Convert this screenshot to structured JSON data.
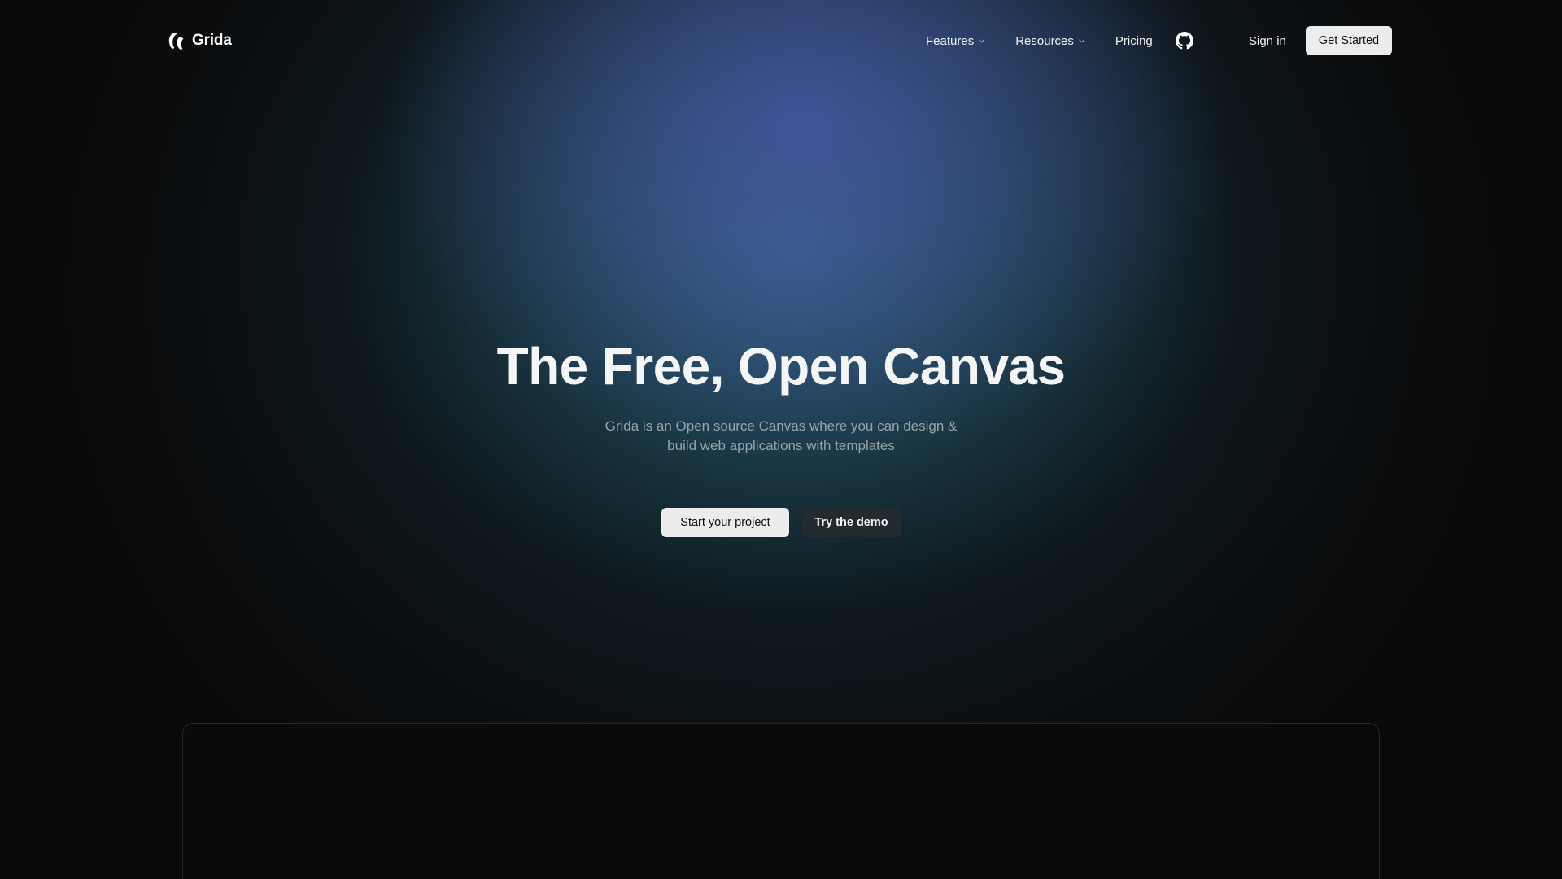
{
  "brand": {
    "name": "Grida",
    "logo_icon": "grida-logo-icon"
  },
  "nav": {
    "items": [
      {
        "label": "Features",
        "has_dropdown": true,
        "icon": "chevron-down-icon"
      },
      {
        "label": "Resources",
        "has_dropdown": true,
        "icon": "chevron-down-icon"
      },
      {
        "label": "Pricing",
        "has_dropdown": false
      }
    ],
    "github_icon": "github-icon",
    "sign_in_label": "Sign in",
    "get_started_label": "Get Started"
  },
  "hero": {
    "title": "The Free, Open Canvas",
    "subtitle_line1": "Grida is an Open source Canvas where you can design &",
    "subtitle_line2": "build web applications with templates",
    "primary_cta": "Start your project",
    "secondary_cta": "Try the demo"
  },
  "colors": {
    "background": "#0a0a0b",
    "glow_blue": "#4a58aa",
    "glow_teal": "#346c8c",
    "button_light": "#ececec",
    "button_dark": "#262c30",
    "subtitle_text": "#9aa3ab"
  }
}
